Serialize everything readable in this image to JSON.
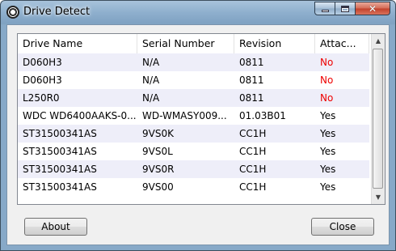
{
  "window": {
    "title": "Drive Detect"
  },
  "list": {
    "columns": [
      "Drive Name",
      "Serial Number",
      "Revision",
      "Attac..."
    ],
    "rows": [
      {
        "drive": "D060H3",
        "serial": "N/A",
        "revision": "0811",
        "attached": "No"
      },
      {
        "drive": "D060H3",
        "serial": "N/A",
        "revision": "0811",
        "attached": "No"
      },
      {
        "drive": "L250R0",
        "serial": "N/A",
        "revision": "0811",
        "attached": "No"
      },
      {
        "drive": "WDC WD6400AAKS-0...",
        "serial": "WD-WMASY009...",
        "revision": "01.03B01",
        "attached": "Yes"
      },
      {
        "drive": "ST31500341AS",
        "serial": "9VS0K",
        "revision": "CC1H",
        "attached": "Yes"
      },
      {
        "drive": "ST31500341AS",
        "serial": "9VS0L",
        "revision": "CC1H",
        "attached": "Yes"
      },
      {
        "drive": "ST31500341AS",
        "serial": "9VS0R",
        "revision": "CC1H",
        "attached": "Yes"
      },
      {
        "drive": "ST31500341AS",
        "serial": "9VS00",
        "revision": "CC1H",
        "attached": "Yes"
      }
    ]
  },
  "buttons": {
    "about": "About",
    "close": "Close"
  },
  "colors": {
    "no_status": "#e00000",
    "alt_row": "#eeeef9"
  }
}
